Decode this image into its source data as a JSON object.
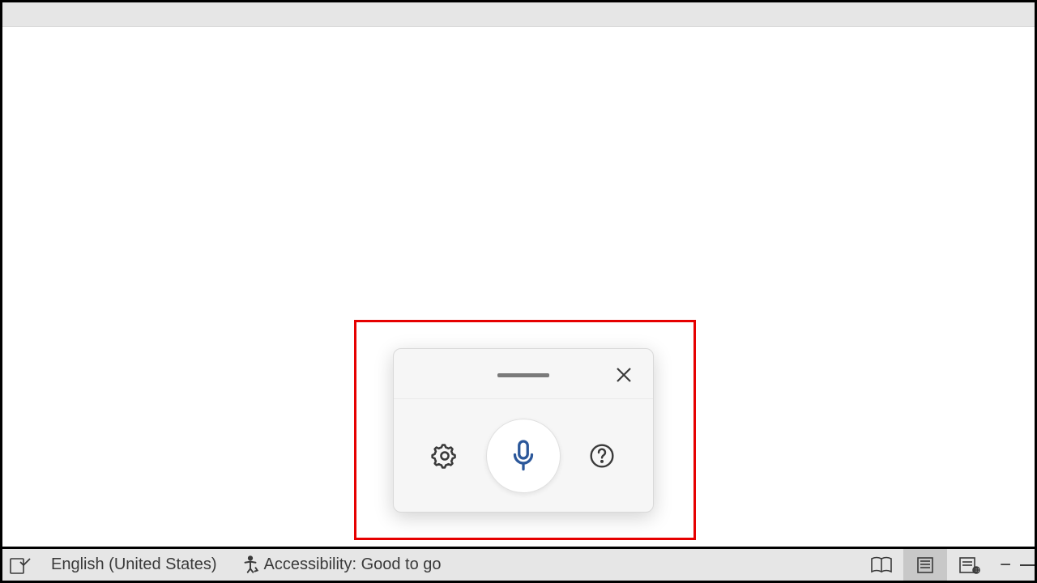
{
  "status_bar": {
    "language": "English (United States)",
    "accessibility": "Accessibility: Good to go"
  },
  "dictation": {
    "icons": {
      "settings": "gear-icon",
      "microphone": "microphone-icon",
      "help": "help-icon",
      "close": "close-icon",
      "drag": "drag-handle"
    },
    "colors": {
      "mic_accent": "#2b579a",
      "highlight_border": "#e60000"
    }
  },
  "view_modes": {
    "read": "read-mode",
    "print": "print-layout",
    "web": "web-layout"
  }
}
